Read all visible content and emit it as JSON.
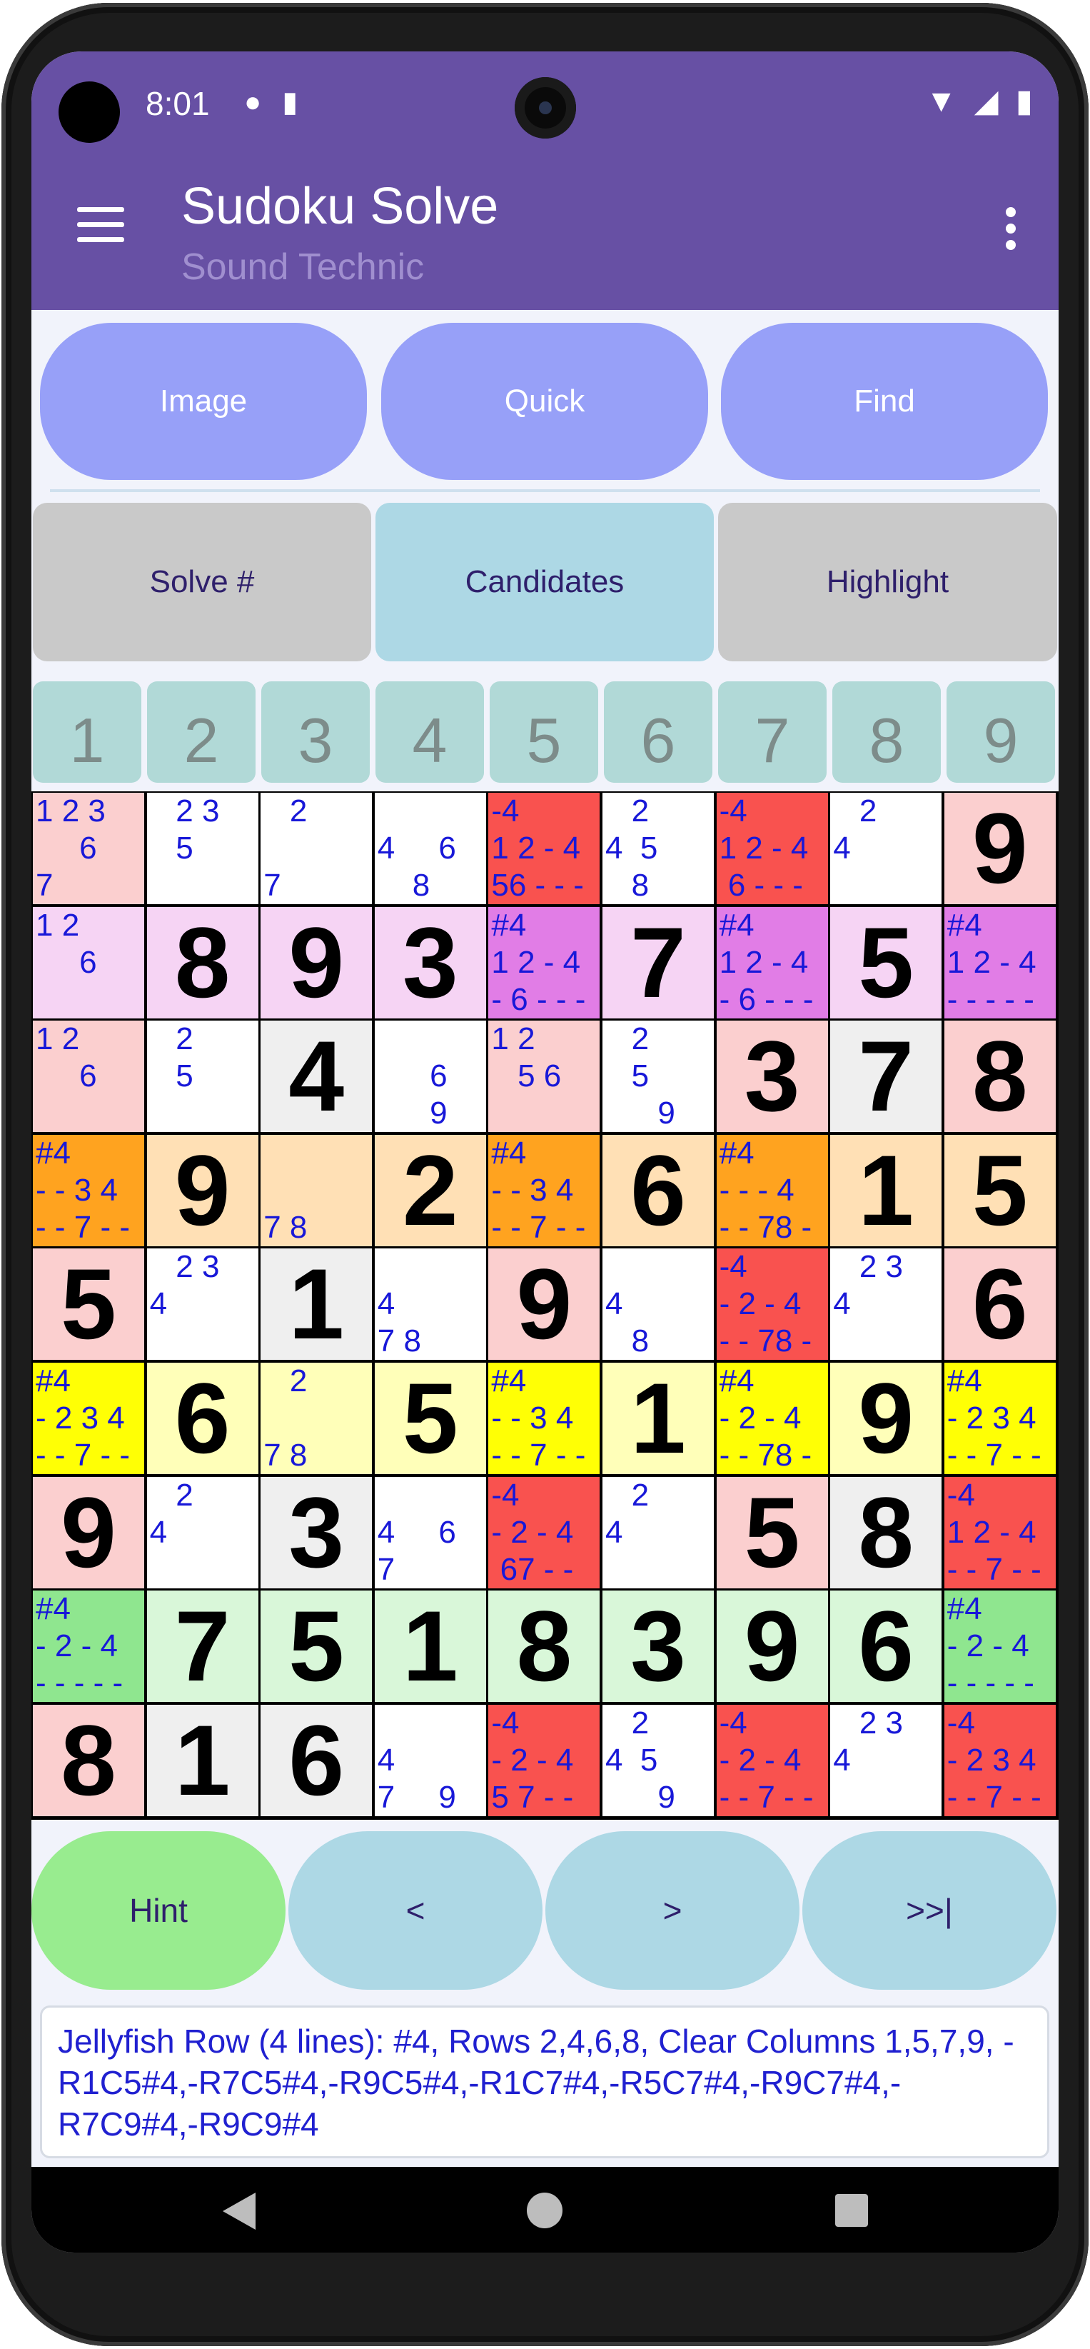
{
  "status": {
    "time": "8:01",
    "left_icons": [
      "notification-icon",
      "sd-card-icon"
    ],
    "right_icons": [
      "wifi-icon",
      "signal-icon",
      "battery-icon"
    ]
  },
  "appbar": {
    "title": "Sudoku Solve",
    "subtitle": "Sound Technic"
  },
  "top_buttons": [
    "Image",
    "Quick",
    "Find"
  ],
  "mid_buttons": [
    {
      "label": "Solve #",
      "color": "#c9c9c9"
    },
    {
      "label": "Candidates",
      "color": "#add8e5"
    },
    {
      "label": "Highlight",
      "color": "#c9c9c9"
    }
  ],
  "column_headers": [
    "1",
    "2",
    "3",
    "4",
    "5",
    "6",
    "7",
    "8",
    "9"
  ],
  "grid": [
    [
      {
        "c": "1 2 3\n     6\n7",
        "bg": "#fbcfcf"
      },
      {
        "c": "   2 3\n   5",
        "bg": "#ffffff"
      },
      {
        "c": "   2\n\n7",
        "bg": "#ffffff"
      },
      {
        "c": "\n4     6\n    8",
        "bg": "#ffffff"
      },
      {
        "c": "-4\n1 2 - 4\n56 - - -",
        "bg": "#f9524f"
      },
      {
        "c": "   2\n4  5\n   8",
        "bg": "#ffffff"
      },
      {
        "c": "-4\n1 2 - 4\n 6 - - -",
        "bg": "#f9524f"
      },
      {
        "c": "   2\n4",
        "bg": "#ffffff"
      },
      {
        "v": "9",
        "bg": "#fbcfcf"
      }
    ],
    [
      {
        "c": "1 2\n     6",
        "bg": "#f6d4f4"
      },
      {
        "v": "8",
        "bg": "#f6d4f4"
      },
      {
        "v": "9",
        "bg": "#f6d4f4"
      },
      {
        "v": "3",
        "bg": "#f6d4f4"
      },
      {
        "c": "#4\n1 2 - 4\n- 6 - - -",
        "bg": "#e17de6"
      },
      {
        "v": "7",
        "bg": "#f6d4f4"
      },
      {
        "c": "#4\n1 2 - 4\n- 6 - - -",
        "bg": "#e17de6"
      },
      {
        "v": "5",
        "bg": "#f6d4f4"
      },
      {
        "c": "#4\n1 2 - 4\n- - - - -",
        "bg": "#e17de6"
      }
    ],
    [
      {
        "c": "1 2\n     6",
        "bg": "#fbcfcf"
      },
      {
        "c": "   2\n   5",
        "bg": "#ffffff"
      },
      {
        "v": "4",
        "bg": "#efefef"
      },
      {
        "c": "\n      6\n      9",
        "bg": "#ffffff"
      },
      {
        "c": "1 2\n   5 6",
        "bg": "#fbcfcf"
      },
      {
        "c": "   2\n   5\n      9",
        "bg": "#ffffff"
      },
      {
        "v": "3",
        "bg": "#fbcfcf"
      },
      {
        "v": "7",
        "bg": "#efefef"
      },
      {
        "v": "8",
        "bg": "#fbcfcf"
      }
    ],
    [
      {
        "c": "#4\n- - 3 4\n- - 7 - -",
        "bg": "#ffa31f"
      },
      {
        "v": "9",
        "bg": "#ffe0b5"
      },
      {
        "c": "\n\n7 8",
        "bg": "#ffe0b5"
      },
      {
        "v": "2",
        "bg": "#ffe0b5"
      },
      {
        "c": "#4\n- - 3 4\n- - 7 - -",
        "bg": "#ffa31f"
      },
      {
        "v": "6",
        "bg": "#ffe0b5"
      },
      {
        "c": "#4\n- - - 4\n- - 78 -",
        "bg": "#ffa31f"
      },
      {
        "v": "1",
        "bg": "#ffe0b5"
      },
      {
        "v": "5",
        "bg": "#ffe0b5"
      }
    ],
    [
      {
        "v": "5",
        "bg": "#fbcfcf"
      },
      {
        "c": "   2 3\n4",
        "bg": "#ffffff"
      },
      {
        "v": "1",
        "bg": "#efefef"
      },
      {
        "c": "\n4\n7 8",
        "bg": "#ffffff"
      },
      {
        "v": "9",
        "bg": "#fbcfcf"
      },
      {
        "c": "\n4\n   8",
        "bg": "#ffffff"
      },
      {
        "c": "-4\n- 2 - 4\n- - 78 -",
        "bg": "#f9524f"
      },
      {
        "c": "   2 3\n4",
        "bg": "#ffffff"
      },
      {
        "v": "6",
        "bg": "#fbcfcf"
      }
    ],
    [
      {
        "c": "#4\n- 2 3 4\n- - 7 - -",
        "bg": "#ffff05"
      },
      {
        "v": "6",
        "bg": "#ffffb9"
      },
      {
        "c": "   2\n\n7 8",
        "bg": "#ffffb9"
      },
      {
        "v": "5",
        "bg": "#ffffb9"
      },
      {
        "c": "#4\n- - 3 4\n- - 7 - -",
        "bg": "#ffff05"
      },
      {
        "v": "1",
        "bg": "#ffffb9"
      },
      {
        "c": "#4\n- 2 - 4\n- - 78 -",
        "bg": "#ffff05"
      },
      {
        "v": "9",
        "bg": "#ffffb9"
      },
      {
        "c": "#4\n- 2 3 4\n- - 7 - -",
        "bg": "#ffff05"
      }
    ],
    [
      {
        "v": "9",
        "bg": "#fbcfcf"
      },
      {
        "c": "   2\n4",
        "bg": "#ffffff"
      },
      {
        "v": "3",
        "bg": "#efefef"
      },
      {
        "c": "\n4     6\n7",
        "bg": "#ffffff"
      },
      {
        "c": "-4\n- 2 - 4\n 67 - -",
        "bg": "#f9524f"
      },
      {
        "c": "   2\n4",
        "bg": "#ffffff"
      },
      {
        "v": "5",
        "bg": "#fbcfcf"
      },
      {
        "v": "8",
        "bg": "#efefef"
      },
      {
        "c": "-4\n1 2 - 4\n- - 7 - -",
        "bg": "#f9524f"
      }
    ],
    [
      {
        "c": "#4\n- 2 - 4\n- - - - -",
        "bg": "#8fe68f"
      },
      {
        "v": "7",
        "bg": "#d9f7d9"
      },
      {
        "v": "5",
        "bg": "#d9f7d9"
      },
      {
        "v": "1",
        "bg": "#d9f7d9"
      },
      {
        "v": "8",
        "bg": "#d9f7d9"
      },
      {
        "v": "3",
        "bg": "#d9f7d9"
      },
      {
        "v": "9",
        "bg": "#d9f7d9"
      },
      {
        "v": "6",
        "bg": "#d9f7d9"
      },
      {
        "c": "#4\n- 2 - 4\n- - - - -",
        "bg": "#8fe68f"
      }
    ],
    [
      {
        "v": "8",
        "bg": "#fbcfcf"
      },
      {
        "v": "1",
        "bg": "#efefef"
      },
      {
        "v": "6",
        "bg": "#efefef"
      },
      {
        "c": "\n4\n7     9",
        "bg": "#ffffff"
      },
      {
        "c": "-4\n- 2 - 4\n5 7 - -",
        "bg": "#f9524f"
      },
      {
        "c": "   2\n4  5\n      9",
        "bg": "#ffffff"
      },
      {
        "c": "-4\n- 2 - 4\n- - 7 - -",
        "bg": "#f9524f"
      },
      {
        "c": "   2 3\n4",
        "bg": "#ffffff"
      },
      {
        "c": "-4\n- 2 3 4\n- - 7 - -",
        "bg": "#f9524f"
      }
    ]
  ],
  "bottom_buttons": [
    {
      "label": "Hint",
      "color": "#98ec8f"
    },
    {
      "label": "<",
      "color": "#add8e5"
    },
    {
      "label": ">",
      "color": "#add8e5"
    },
    {
      "label": ">>|",
      "color": "#add8e5"
    }
  ],
  "message": "Jellyfish Row (4 lines): #4, Rows 2,4,6,8, Clear Columns 1,5,7,9, -R1C5#4,-R7C5#4,-R9C5#4,-R1C7#4,-R5C7#4,-R9C7#4,-R7C9#4,-R9C9#4",
  "nav": [
    "back-icon",
    "home-icon",
    "recents-icon"
  ]
}
